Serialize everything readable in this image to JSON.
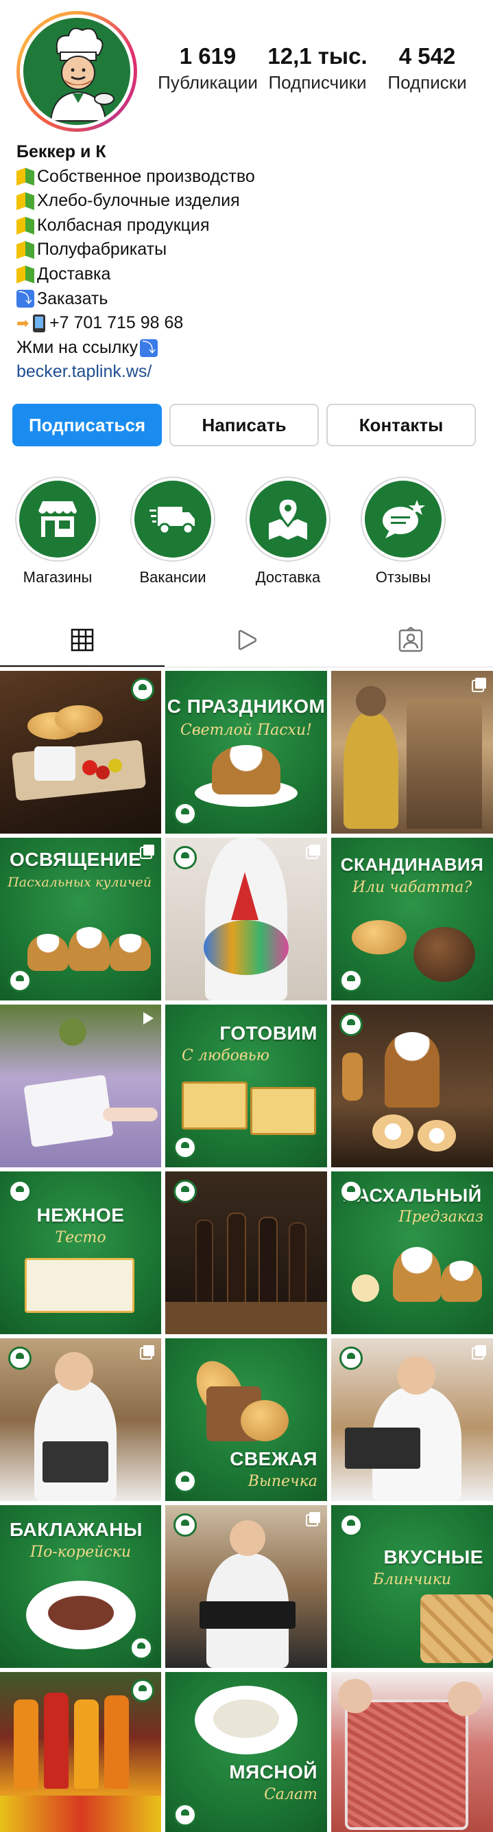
{
  "profile": {
    "stats": [
      {
        "value": "1 619",
        "label": "Публикации"
      },
      {
        "value": "12,1 тыс.",
        "label": "Подписчики"
      },
      {
        "value": "4 542",
        "label": "Подписки"
      }
    ],
    "name": "Беккер и К",
    "bio_lines": [
      {
        "icon": "beginner-icon",
        "text": "Собственное производство"
      },
      {
        "icon": "beginner-icon",
        "text": "Хлебо-булочные изделия"
      },
      {
        "icon": "beginner-icon",
        "text": "Колбасная продукция"
      },
      {
        "icon": "beginner-icon",
        "text": "Полуфабрикаты"
      },
      {
        "icon": "beginner-icon",
        "text": "Доставка"
      },
      {
        "icon": "arrow-down-icon",
        "text": "Заказать"
      },
      {
        "icon": "phone-icon",
        "text": "+7 701 715 98 68"
      },
      {
        "icon": "arrow-down-icon",
        "text": "Жми на ссылку"
      }
    ],
    "link": "becker.taplink.ws/"
  },
  "actions": {
    "follow": "Подписаться",
    "message": "Написать",
    "contacts": "Контакты"
  },
  "colors": {
    "brand_green": "#1b7533",
    "follow_blue": "#1a8cf0",
    "link": "#1f4e91"
  },
  "highlights": [
    {
      "label": "Магазины",
      "icon": "store-icon"
    },
    {
      "label": "Вакансии",
      "icon": "delivery-truck-icon"
    },
    {
      "label": "Доставка",
      "icon": "map-pin-icon"
    },
    {
      "label": "Отзывы",
      "icon": "chat-star-icon"
    }
  ],
  "tabs": [
    {
      "name": "grid-icon",
      "active": true
    },
    {
      "name": "reels-icon",
      "active": false
    },
    {
      "name": "tagged-icon",
      "active": false
    }
  ],
  "posts": [
    {
      "title": "",
      "subtitle": ""
    },
    {
      "title": "С ПРАЗДНИКОМ",
      "subtitle": "Светлой Пасхи!"
    },
    {
      "title": "",
      "subtitle": ""
    },
    {
      "title": "ОСВЯЩЕНИЕ",
      "subtitle": "Пасхальных куличей"
    },
    {
      "title": "",
      "subtitle": ""
    },
    {
      "title": "СКАНДИНАВИЯ",
      "subtitle": "Или чабатта?"
    },
    {
      "title": "",
      "subtitle": ""
    },
    {
      "title": "ГОТОВИМ",
      "subtitle": "С любовью"
    },
    {
      "title": "",
      "subtitle": ""
    },
    {
      "title": "НЕЖНОЕ",
      "subtitle": "Тесто"
    },
    {
      "title": "",
      "subtitle": ""
    },
    {
      "title": "ПАСХАЛЬНЫЙ",
      "subtitle": "Предзаказ"
    },
    {
      "title": "",
      "subtitle": ""
    },
    {
      "title": "СВЕЖАЯ",
      "subtitle": "Выпечка"
    },
    {
      "title": "",
      "subtitle": ""
    },
    {
      "title": "БАКЛАЖАНЫ",
      "subtitle": "По-корейски"
    },
    {
      "title": "",
      "subtitle": ""
    },
    {
      "title": "ВКУСНЫЕ",
      "subtitle": "Блинчики"
    },
    {
      "title": "",
      "subtitle": ""
    },
    {
      "title": "МЯСНОЙ",
      "subtitle": "Салат"
    },
    {
      "title": "",
      "subtitle": ""
    }
  ]
}
